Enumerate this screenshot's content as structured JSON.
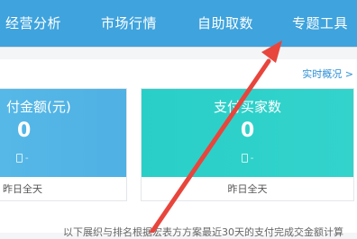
{
  "nav": {
    "items": [
      {
        "label": "经营分析"
      },
      {
        "label": "市场行情"
      },
      {
        "label": "自助取数"
      },
      {
        "label": "专题工具"
      }
    ]
  },
  "realtime": {
    "label": "实时概况 >"
  },
  "cards": [
    {
      "title": "付金额(元)",
      "value": "0",
      "device": "-",
      "period": "昨日全天",
      "color": "#52b5e5"
    },
    {
      "title": "支付买家数",
      "value": "0",
      "device": "-",
      "period": "昨日全天",
      "color": "#2ed1c9"
    }
  ],
  "note": {
    "text": "以下展织与排名根据宏表方方案最近30天的支付完成交金额计算"
  },
  "colors": {
    "nav_bg": "#3fa3dd",
    "link": "#2a8fd6",
    "annotation": "#e8453c"
  }
}
